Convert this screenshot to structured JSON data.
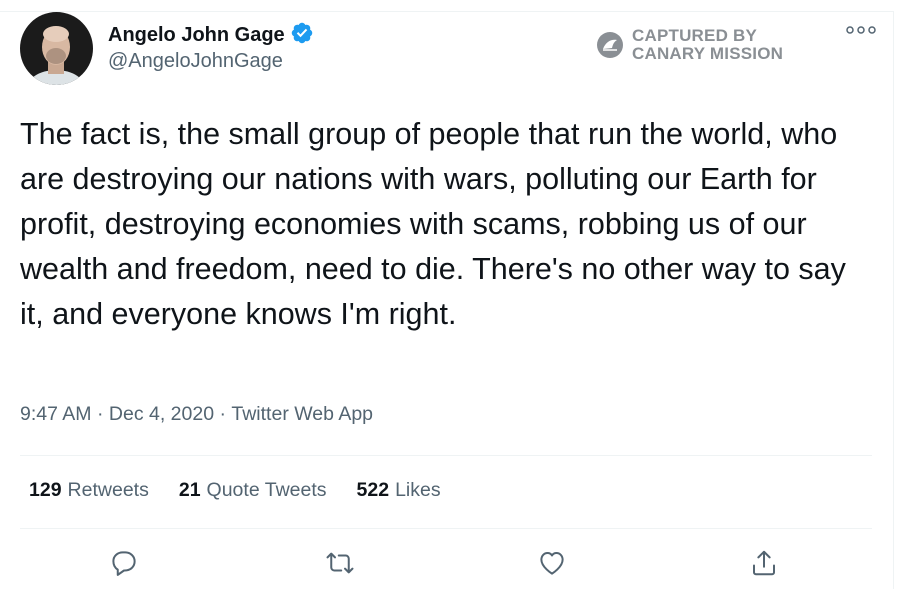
{
  "tweet": {
    "author_name": "Angelo John Gage",
    "handle": "@AngeloJohnGage",
    "verified": true,
    "text": "The fact is, the small group of people that run the world, who are destroying our nations with wars, polluting our Earth for profit, destroying economies with scams, robbing us of our wealth and freedom, need to die. There's no other way to say it, and everyone knows I'm right.",
    "time": "9:47 AM",
    "date": "Dec 4, 2020",
    "source": "Twitter Web App",
    "separator": " · "
  },
  "watermark": {
    "line1": "CAPTURED BY",
    "line2": "CANARY MISSION"
  },
  "stats": {
    "retweets_count": "129",
    "retweets_label": "Retweets",
    "quote_count": "21",
    "quote_label": "Quote Tweets",
    "likes_count": "522",
    "likes_label": "Likes"
  },
  "actions": [
    {
      "icon": "reply-icon"
    },
    {
      "icon": "retweet-icon"
    },
    {
      "icon": "like-icon"
    },
    {
      "icon": "share-icon"
    }
  ],
  "colors": {
    "verified_blue": "#1d9bf0",
    "text": "#0f1419",
    "secondary": "#536471",
    "watermark": "#8a8f94"
  }
}
